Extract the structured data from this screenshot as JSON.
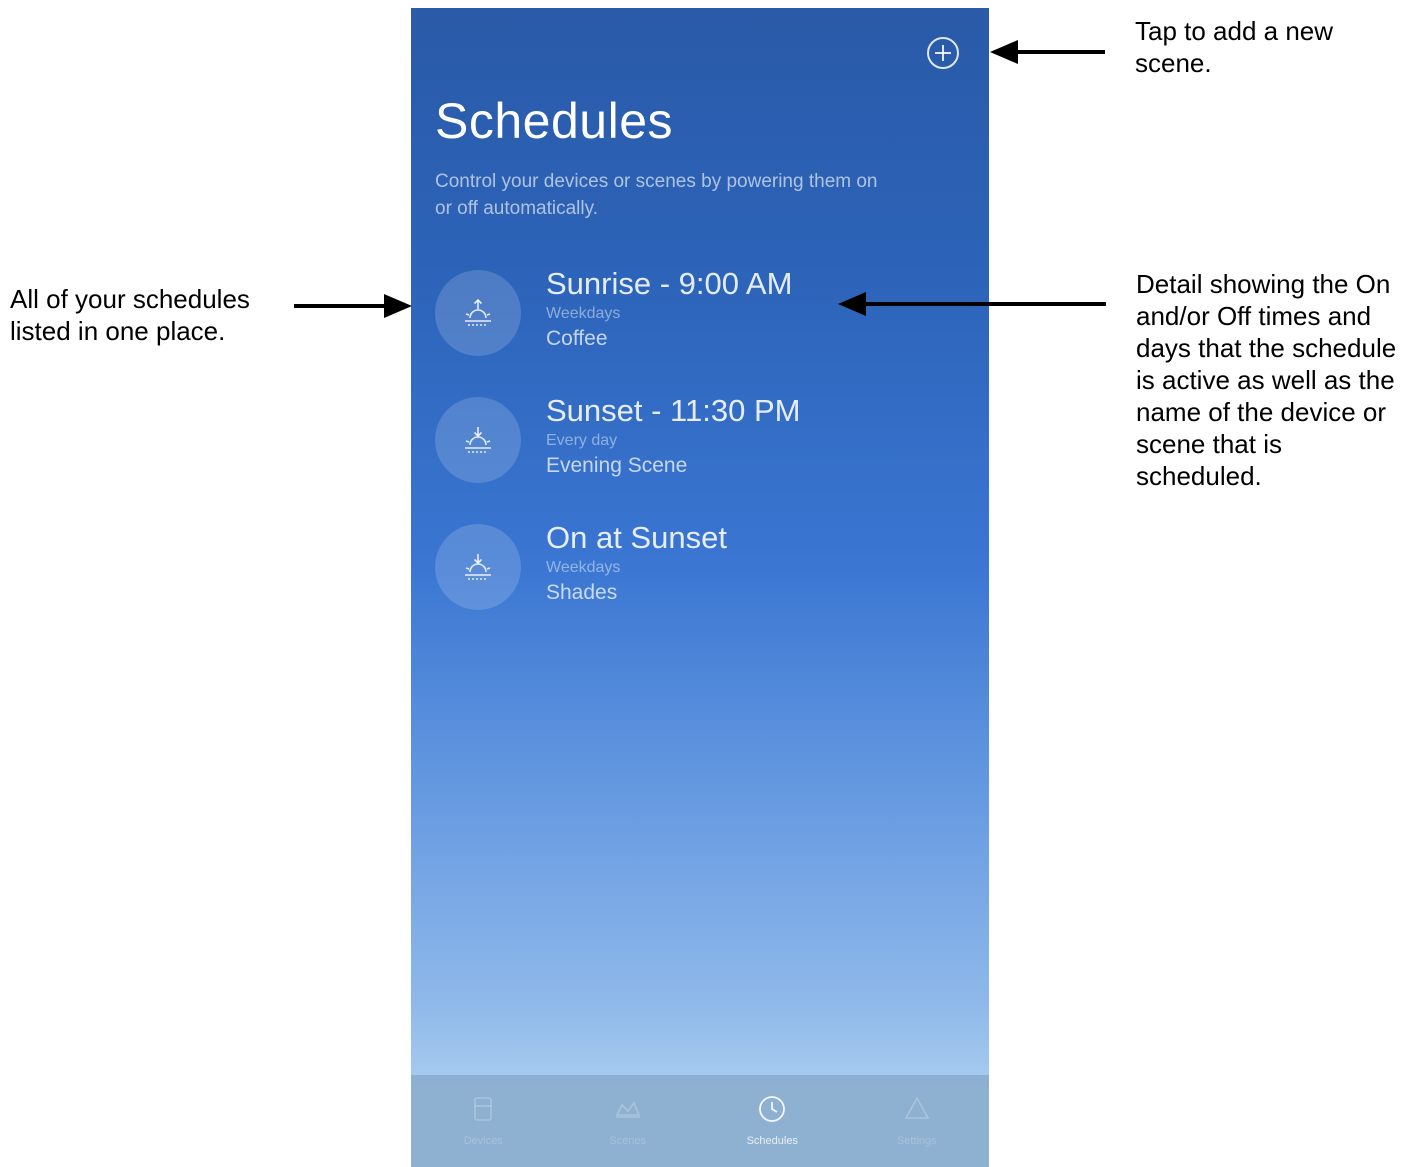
{
  "app": {
    "title": "Schedules",
    "subtitle": "Control your devices or scenes by powering them on or off automatically.",
    "add_button_icon": "plus-circle-icon"
  },
  "schedules": [
    {
      "title": "Sunrise - 9:00 AM",
      "days": "Weekdays",
      "target": "Coffee",
      "icon": "sunrise-icon"
    },
    {
      "title": "Sunset - 11:30 PM",
      "days": "Every day",
      "target": "Evening Scene",
      "icon": "sunset-icon"
    },
    {
      "title": "On at Sunset",
      "days": "Weekdays",
      "target": "Shades",
      "icon": "sunset-icon"
    }
  ],
  "tabs": [
    {
      "label": "Devices",
      "icon": "devices-icon",
      "active": false
    },
    {
      "label": "Scenes",
      "icon": "scenes-icon",
      "active": false
    },
    {
      "label": "Schedules",
      "icon": "clock-icon",
      "active": true
    },
    {
      "label": "Settings",
      "icon": "settings-icon",
      "active": false
    }
  ],
  "annotations": {
    "add_scene": "Tap to add a new scene.",
    "list": "All of your schedules listed in one place.",
    "detail": "Detail showing the On and/or Off times and days that the schedule is active as well as the name of the device or scene that is scheduled."
  },
  "colors": {
    "gradient_top": "#2a5aa8",
    "gradient_bottom": "#a8ccef",
    "text": "#ffffff"
  }
}
